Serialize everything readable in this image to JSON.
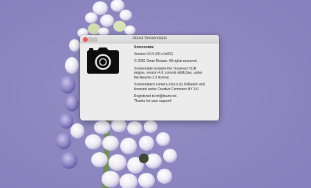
{
  "window": {
    "title": "About Screenotate"
  },
  "icons": {
    "app": "camera-icon",
    "close": "close-icon",
    "minimize": "minimize-icon",
    "zoom": "zoom-icon"
  },
  "about": {
    "app_name": "Screenotate",
    "version": "Version 3.0.0 (59-c1c6f2)",
    "copyright": "© 2020 Omar Rizwan. All rights reserved.",
    "ocr_notice": [
      "Screenotate includes the Tesseract OCR",
      "engine, version 4.0, commit ebbfc3ae, under",
      "the Apache 2.0 license."
    ],
    "icon_credit": [
      "Screenotate's camera icon is by Kidiladon and",
      "licensed under Creative Commons BY 3.0."
    ],
    "registration": "Registered to tnt@team.net.",
    "thanks": "Thanks for your support!"
  },
  "colors": {
    "close_button": "#fc5f57",
    "window_background": "#ececec",
    "wallpaper": "#8f87c2"
  }
}
